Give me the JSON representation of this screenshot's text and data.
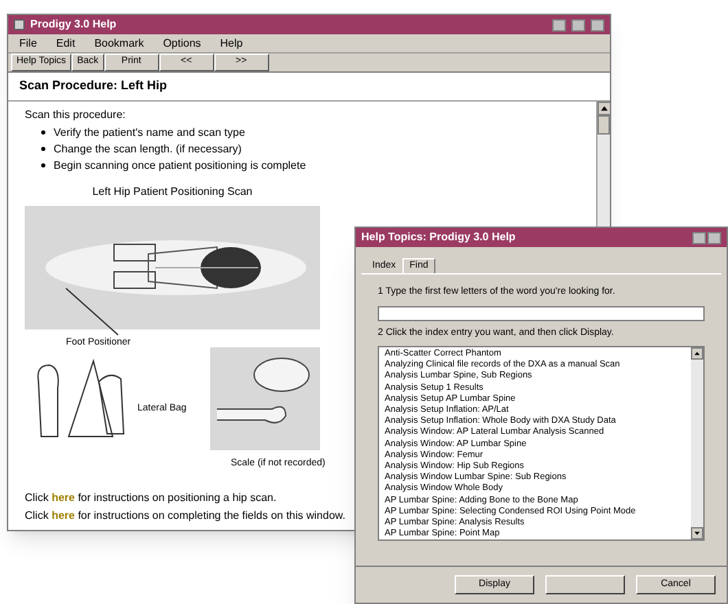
{
  "help_window": {
    "title": "Prodigy 3.0 Help",
    "menu": [
      "File",
      "Edit",
      "Bookmark",
      "Options",
      "Help"
    ],
    "toolbar": [
      "Help Topics",
      "Back",
      "Print",
      "<<",
      ">>"
    ],
    "heading": "Scan Procedure: Left Hip",
    "intro": "Scan this procedure:",
    "steps": [
      "Verify the patient's name and scan type",
      "Change the scan length. (if necessary)",
      "Begin scanning once patient positioning is complete"
    ],
    "figure_title": "Left Hip Patient Positioning Scan",
    "figure_labels": [
      "Foot Positioner",
      "Lateral Bag",
      "Scale (if not recorded)"
    ],
    "links": [
      "Click **here** for instructions on positioning a hip scan.",
      "Click **here** for instructions on completing the fields on this window."
    ]
  },
  "topics_dialog": {
    "title": "Help Topics: Prodigy 3.0 Help",
    "tabs": [
      {
        "label": "Index",
        "selected": false
      },
      {
        "label": "Find",
        "selected": true
      }
    ],
    "step_1": "1  Type the first few letters of the word you're looking for.",
    "step_2": "2  Click the index entry you want, and then click Display.",
    "entries": [
      "Anti-Scatter Correct Phantom",
      "Analyzing Clinical file records of the DXA as a manual Scan",
      "Analysis Lumbar Spine, Sub Regions",
      "Analysis Setup 1 Results",
      "Analysis Setup AP Lumbar Spine",
      "Analysis Setup Inflation: AP/Lat",
      "Analysis Setup Inflation: Whole Body with DXA Study Data",
      "Analysis Window: AP Lateral Lumbar Analysis Scanned",
      "Analysis Window: AP Lumbar Spine",
      "Analysis Window: Femur",
      "Analysis Window: Hip Sub Regions",
      "Analysis Window Lumbar Spine: Sub Regions",
      "Analysis Window Whole Body",
      "AP Lumbar Spine: Adding Bone to the Bone Map",
      "AP Lumbar Spine: Selecting Condensed ROI Using Point Mode",
      "AP Lumbar Spine: Analysis Results",
      "AP Lumbar Spine: Point Map"
    ],
    "buttons": [
      "Display",
      "Cancel"
    ]
  }
}
